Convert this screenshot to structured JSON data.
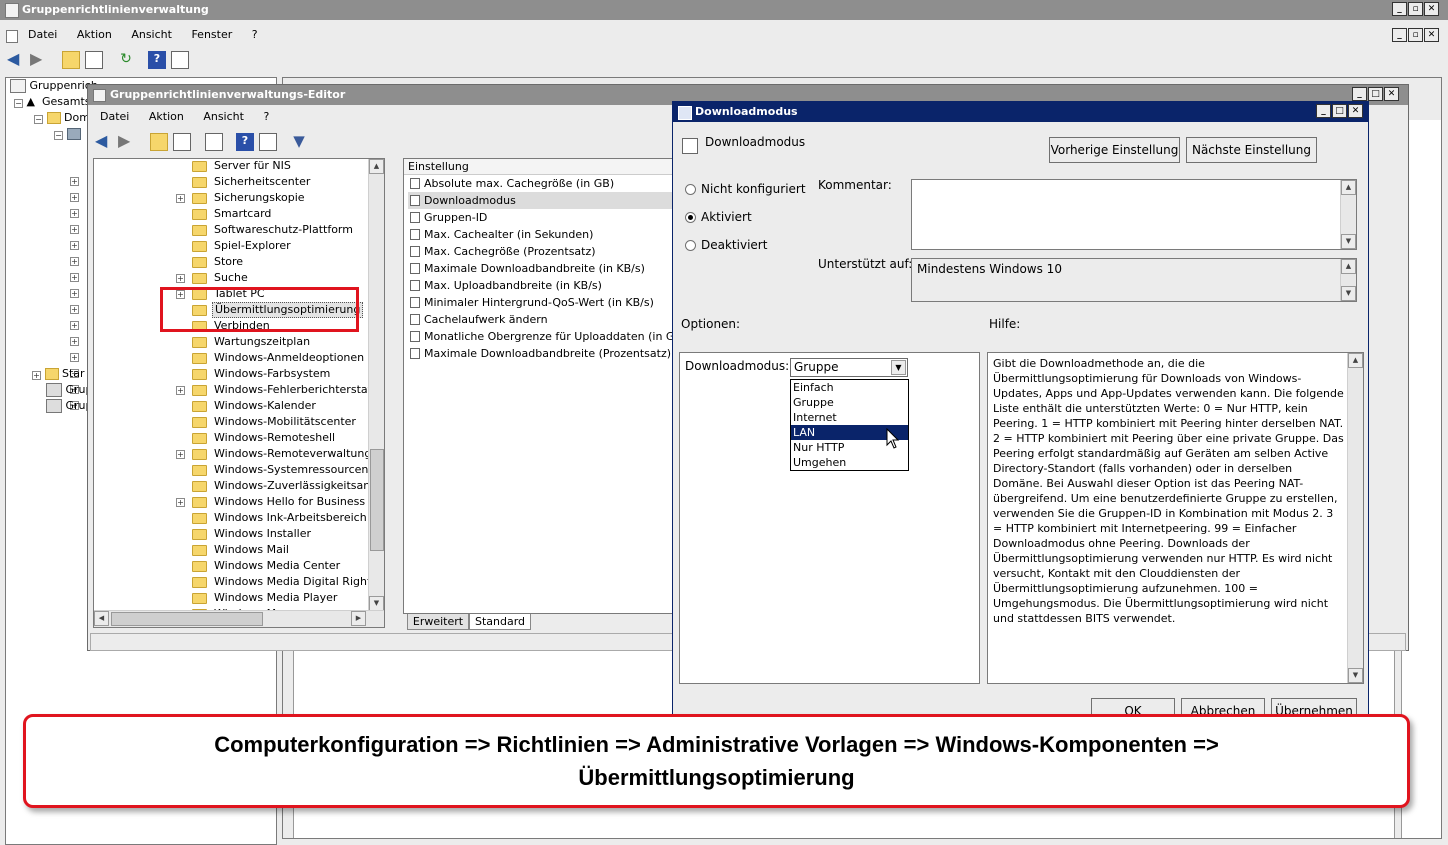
{
  "outer": {
    "title": "Gruppenrichtlinienverwaltung",
    "menu": [
      "Datei",
      "Aktion",
      "Ansicht",
      "Fenster",
      "?"
    ],
    "tree": [
      "Gruppenrich",
      "Gesamts",
      "Dom",
      "",
      "",
      "",
      "",
      "",
      "",
      "",
      "",
      "",
      "",
      "",
      "",
      "",
      "",
      "Star",
      "Grup",
      "Grup"
    ]
  },
  "editor": {
    "title": "Gruppenrichtlinienverwaltungs-Editor",
    "menu": [
      "Datei",
      "Aktion",
      "Ansicht",
      "?"
    ],
    "tree_items": [
      {
        "label": "Server für NIS",
        "expander": false
      },
      {
        "label": "Sicherheitscenter",
        "expander": false
      },
      {
        "label": "Sicherungskopie",
        "expander": true
      },
      {
        "label": "Smartcard",
        "expander": false
      },
      {
        "label": "Softwareschutz-Plattform",
        "expander": false
      },
      {
        "label": "Spiel-Explorer",
        "expander": false
      },
      {
        "label": "Store",
        "expander": false
      },
      {
        "label": "Suche",
        "expander": true
      },
      {
        "label": "Tablet PC",
        "expander": true
      },
      {
        "label": "Übermittlungsoptimierung",
        "expander": false,
        "selected": true
      },
      {
        "label": "Verbinden",
        "expander": false
      },
      {
        "label": "Wartungszeitplan",
        "expander": false
      },
      {
        "label": "Windows-Anmeldeoptionen",
        "expander": false
      },
      {
        "label": "Windows-Farbsystem",
        "expander": false
      },
      {
        "label": "Windows-Fehlerberichterstattung",
        "expander": true
      },
      {
        "label": "Windows-Kalender",
        "expander": false
      },
      {
        "label": "Windows-Mobilitätscenter",
        "expander": false
      },
      {
        "label": "Windows-Remoteshell",
        "expander": false
      },
      {
        "label": "Windows-Remoteverwaltung (Wind",
        "expander": true
      },
      {
        "label": "Windows-Systemressourcen-Manag",
        "expander": false
      },
      {
        "label": "Windows-Zuverlässigkeitsanalyse",
        "expander": false
      },
      {
        "label": "Windows Hello for Business",
        "expander": true
      },
      {
        "label": "Windows Ink-Arbeitsbereich",
        "expander": false
      },
      {
        "label": "Windows Installer",
        "expander": false
      },
      {
        "label": "Windows Mail",
        "expander": false
      },
      {
        "label": "Windows Media Center",
        "expander": false
      },
      {
        "label": "Windows Media Digital Rights Mana",
        "expander": false
      },
      {
        "label": "Windows Media Player",
        "expander": false
      },
      {
        "label": "Windows M...",
        "expander": false
      }
    ],
    "list_header": "Einstellung",
    "settings": [
      "Absolute max. Cachegröße (in GB)",
      "Downloadmodus",
      "Gruppen-ID",
      "Max. Cachealter (in Sekunden)",
      "Max. Cachegröße (Prozentsatz)",
      "Maximale Downloadbandbreite (in KB/s)",
      "Max. Uploadbandbreite (in KB/s)",
      "Minimaler Hintergrund-QoS-Wert (in KB/s)",
      "Cachelaufwerk ändern",
      "Monatliche Obergrenze für Uploaddaten (in GB)",
      "Maximale Downloadbandbreite (Prozentsatz)"
    ],
    "tabs": [
      "Erweitert",
      "Standard"
    ]
  },
  "dialog": {
    "title": "Downloadmodus",
    "setting_name": "Downloadmodus",
    "prev_button": "Vorherige Einstellung",
    "next_button": "Nächste Einstellung",
    "radio_not_configured": "Nicht konfiguriert",
    "radio_enabled": "Aktiviert",
    "radio_disabled": "Deaktiviert",
    "comment_label": "Kommentar:",
    "supported_label": "Unterstützt auf:",
    "supported_value": "Mindestens Windows 10",
    "options_label": "Optionen:",
    "help_label": "Hilfe:",
    "download_mode_label": "Downloadmodus:",
    "download_mode_value": "Gruppe",
    "dropdown_options": [
      "Einfach",
      "Gruppe",
      "Internet",
      "LAN",
      "Nur HTTP",
      "Umgehen"
    ],
    "help_text": "Gibt die Downloadmethode an, die die Übermittlungsoptimierung für Downloads von Windows-Updates, Apps und App-Updates verwenden kann. Die folgende Liste enthält die unterstützten Werte: 0 = Nur HTTP, kein Peering. 1 = HTTP kombiniert mit Peering hinter derselben NAT. 2 = HTTP kombiniert mit Peering über eine private Gruppe. Das Peering erfolgt standardmäßig auf Geräten am selben Active Directory-Standort (falls vorhanden) oder in derselben Domäne. Bei Auswahl dieser Option ist das Peering NAT-übergreifend. Um eine benutzerdefinierte Gruppe zu erstellen, verwenden Sie die Gruppen-ID in Kombination mit Modus 2. 3 = HTTP kombiniert mit Internetpeering. 99 = Einfacher Downloadmodus ohne Peering. Downloads der Übermittlungsoptimierung verwenden nur HTTP. Es wird nicht versucht, Kontakt mit den Clouddiensten der Übermittlungsoptimierung aufzunehmen. 100 = Umgehungsmodus. Die Übermittlungsoptimierung wird nicht und stattdessen BITS verwendet.",
    "ok_button": "OK",
    "cancel_button": "Abbrechen",
    "apply_button": "Übernehmen"
  },
  "annotation": {
    "line1": "Computerkonfiguration => Richtlinien => Administrative Vorlagen => Windows-Komponenten =>",
    "line2": "Übermittlungsoptimierung"
  },
  "colors": {
    "highlight_red": "#e0141e",
    "selection_blue": "#0a246a",
    "inactive_title": "#8e8e8e"
  }
}
